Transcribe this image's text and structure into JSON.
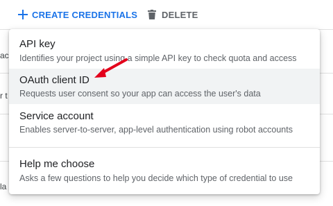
{
  "toolbar": {
    "create_label": "CREATE CREDENTIALS",
    "delete_label": "DELETE"
  },
  "background_fragments": [
    "ac",
    "r t",
    "la"
  ],
  "menu": {
    "items": [
      {
        "title": "API key",
        "description": "Identifies your project using a simple API key to check quota and access"
      },
      {
        "title": "OAuth client ID",
        "description": "Requests user consent so your app can access the user's data"
      },
      {
        "title": "Service account",
        "description": "Enables server-to-server, app-level authentication using robot accounts"
      },
      {
        "title": "Help me choose",
        "description": "Asks a few questions to help you decide which type of credential to use"
      }
    ]
  },
  "colors": {
    "accent": "#1a73e8",
    "annotation_arrow": "#e3001b",
    "hover_row": "#f1f3f4"
  }
}
